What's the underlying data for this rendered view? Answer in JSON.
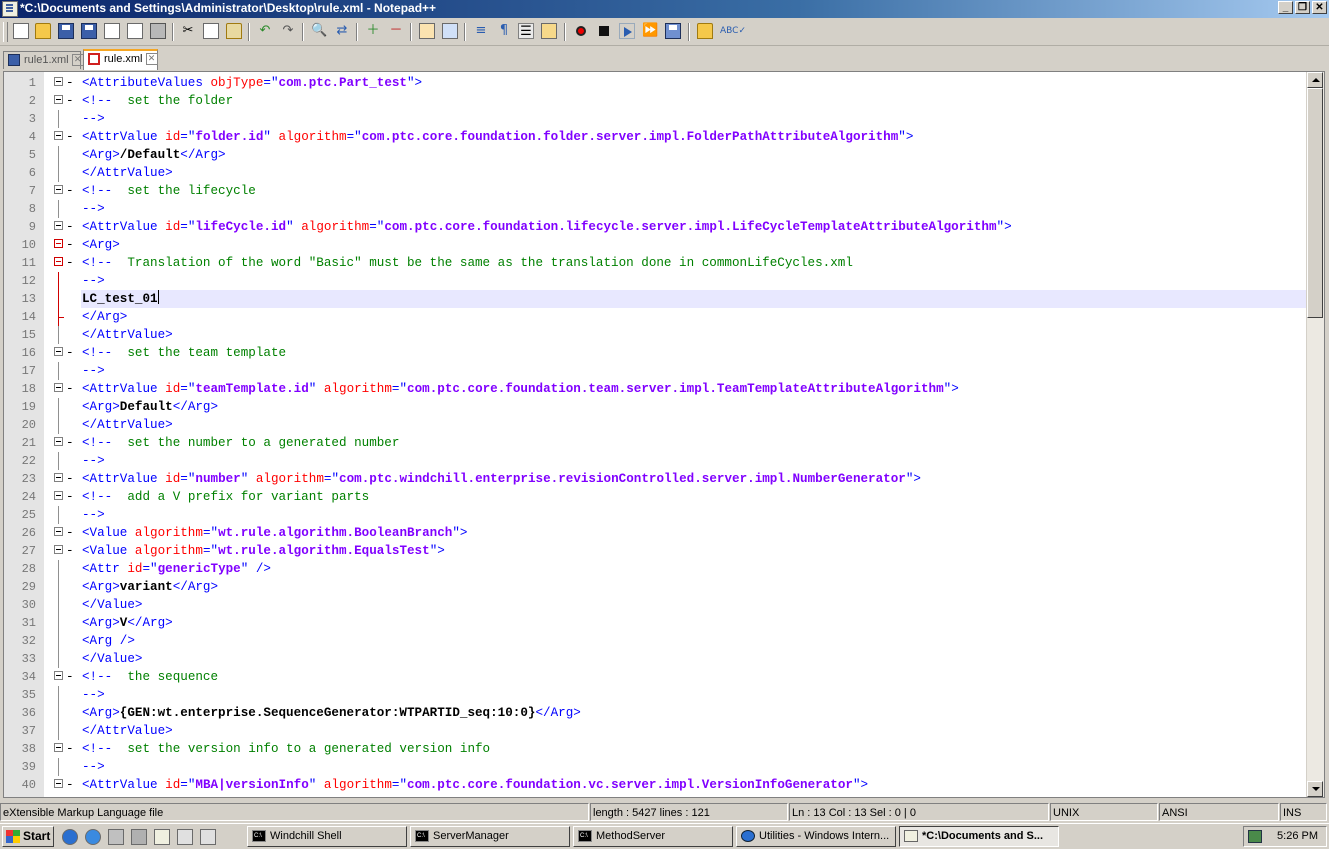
{
  "window": {
    "title": "*C:\\Documents and Settings\\Administrator\\Desktop\\rule.xml - Notepad++",
    "controls": {
      "minimize": "_",
      "restore": "❐",
      "close": "✕"
    }
  },
  "toolbar": {
    "icons": [
      "new-file-icon",
      "open-file-icon",
      "save-icon",
      "save-all-icon",
      "close-icon",
      "close-all-icon",
      "print-icon",
      "cut-icon",
      "copy-icon",
      "paste-icon",
      "undo-icon",
      "redo-icon",
      "find-icon",
      "replace-icon",
      "zoom-in-icon",
      "zoom-out-icon",
      "sync-vertical-icon",
      "sync-horizontal-icon",
      "word-wrap-icon",
      "show-all-chars-icon",
      "indent-guide-icon",
      "user-lang-icon",
      "record-macro-icon",
      "stop-record-icon",
      "play-macro-icon",
      "run-macro-multiple-icon",
      "save-macro-icon",
      "launch-browser-icon",
      "spell-check-icon"
    ]
  },
  "tabs": [
    {
      "label": "rule1.xml",
      "active": false,
      "state": "saved"
    },
    {
      "label": "rule.xml",
      "active": true,
      "state": "modified"
    }
  ],
  "editor": {
    "current_line": 13,
    "lines": [
      {
        "n": "1",
        "fold": "open",
        "parts": [
          [
            "t",
            "<AttributeValues "
          ],
          [
            "a",
            "objType"
          ],
          [
            "t",
            "=\""
          ],
          [
            "v",
            "com.ptc.Part_test"
          ],
          [
            "t",
            "\">"
          ]
        ]
      },
      {
        "n": "2",
        "fold": "open",
        "parts": [
          [
            "t",
            "<!-- "
          ],
          [
            "c",
            " set the folder"
          ]
        ]
      },
      {
        "n": "3",
        "fold": "line",
        "parts": [
          [
            "t",
            "-->"
          ]
        ]
      },
      {
        "n": "4",
        "fold": "open",
        "parts": [
          [
            "t",
            "<AttrValue "
          ],
          [
            "a",
            "id"
          ],
          [
            "t",
            "=\""
          ],
          [
            "v",
            "folder.id"
          ],
          [
            "t",
            "\" "
          ],
          [
            "a",
            "algorithm"
          ],
          [
            "t",
            "=\""
          ],
          [
            "v",
            "com.ptc.core.foundation.folder.server.impl.FolderPathAttributeAlgorithm"
          ],
          [
            "t",
            "\">"
          ]
        ]
      },
      {
        "n": "5",
        "fold": "line",
        "parts": [
          [
            "t",
            "<Arg>"
          ],
          [
            "x",
            "/Default"
          ],
          [
            "t",
            "</Arg>"
          ]
        ]
      },
      {
        "n": "6",
        "fold": "line",
        "parts": [
          [
            "t",
            "</AttrValue>"
          ]
        ]
      },
      {
        "n": "7",
        "fold": "open",
        "parts": [
          [
            "t",
            "<!-- "
          ],
          [
            "c",
            " set the lifecycle"
          ]
        ]
      },
      {
        "n": "8",
        "fold": "line",
        "parts": [
          [
            "t",
            "-->"
          ]
        ]
      },
      {
        "n": "9",
        "fold": "open",
        "parts": [
          [
            "t",
            "<AttrValue "
          ],
          [
            "a",
            "id"
          ],
          [
            "t",
            "=\""
          ],
          [
            "v",
            "lifeCycle.id"
          ],
          [
            "t",
            "\" "
          ],
          [
            "a",
            "algorithm"
          ],
          [
            "t",
            "=\""
          ],
          [
            "v",
            "com.ptc.core.foundation.lifecycle.server.impl.LifeCycleTemplateAttributeAlgorithm"
          ],
          [
            "t",
            "\">"
          ]
        ]
      },
      {
        "n": "10",
        "fold": "open-red",
        "parts": [
          [
            "t",
            "<Arg>"
          ]
        ]
      },
      {
        "n": "11",
        "fold": "open-red",
        "parts": [
          [
            "t",
            "<!-- "
          ],
          [
            "c",
            " Translation of the word \"Basic\" must be the same as the translation done in commonLifeCycles.xml"
          ]
        ]
      },
      {
        "n": "12",
        "fold": "line-red",
        "parts": [
          [
            "t",
            "-->"
          ]
        ]
      },
      {
        "n": "13",
        "fold": "line-red",
        "parts": [
          [
            "x",
            "LC_test_01"
          ]
        ]
      },
      {
        "n": "14",
        "fold": "end-red",
        "parts": [
          [
            "t",
            "</Arg>"
          ]
        ]
      },
      {
        "n": "15",
        "fold": "line",
        "parts": [
          [
            "t",
            "</AttrValue>"
          ]
        ]
      },
      {
        "n": "16",
        "fold": "open",
        "parts": [
          [
            "t",
            "<!-- "
          ],
          [
            "c",
            " set the team template"
          ]
        ]
      },
      {
        "n": "17",
        "fold": "line",
        "parts": [
          [
            "t",
            "-->"
          ]
        ]
      },
      {
        "n": "18",
        "fold": "open",
        "parts": [
          [
            "t",
            "<AttrValue "
          ],
          [
            "a",
            "id"
          ],
          [
            "t",
            "=\""
          ],
          [
            "v",
            "teamTemplate.id"
          ],
          [
            "t",
            "\" "
          ],
          [
            "a",
            "algorithm"
          ],
          [
            "t",
            "=\""
          ],
          [
            "v",
            "com.ptc.core.foundation.team.server.impl.TeamTemplateAttributeAlgorithm"
          ],
          [
            "t",
            "\">"
          ]
        ]
      },
      {
        "n": "19",
        "fold": "line",
        "parts": [
          [
            "t",
            "<Arg>"
          ],
          [
            "x",
            "Default"
          ],
          [
            "t",
            "</Arg>"
          ]
        ]
      },
      {
        "n": "20",
        "fold": "line",
        "parts": [
          [
            "t",
            "</AttrValue>"
          ]
        ]
      },
      {
        "n": "21",
        "fold": "open",
        "parts": [
          [
            "t",
            "<!-- "
          ],
          [
            "c",
            " set the number to a generated number"
          ]
        ]
      },
      {
        "n": "22",
        "fold": "line",
        "parts": [
          [
            "t",
            "-->"
          ]
        ]
      },
      {
        "n": "23",
        "fold": "open",
        "parts": [
          [
            "t",
            "<AttrValue "
          ],
          [
            "a",
            "id"
          ],
          [
            "t",
            "=\""
          ],
          [
            "v",
            "number"
          ],
          [
            "t",
            "\" "
          ],
          [
            "a",
            "algorithm"
          ],
          [
            "t",
            "=\""
          ],
          [
            "v",
            "com.ptc.windchill.enterprise.revisionControlled.server.impl.NumberGenerator"
          ],
          [
            "t",
            "\">"
          ]
        ]
      },
      {
        "n": "24",
        "fold": "open",
        "parts": [
          [
            "t",
            "<!-- "
          ],
          [
            "c",
            " add a V prefix for variant parts"
          ]
        ]
      },
      {
        "n": "25",
        "fold": "line",
        "parts": [
          [
            "t",
            "-->"
          ]
        ]
      },
      {
        "n": "26",
        "fold": "open",
        "parts": [
          [
            "t",
            "<Value "
          ],
          [
            "a",
            "algorithm"
          ],
          [
            "t",
            "=\""
          ],
          [
            "v",
            "wt.rule.algorithm.BooleanBranch"
          ],
          [
            "t",
            "\">"
          ]
        ]
      },
      {
        "n": "27",
        "fold": "open",
        "parts": [
          [
            "t",
            "<Value "
          ],
          [
            "a",
            "algorithm"
          ],
          [
            "t",
            "=\""
          ],
          [
            "v",
            "wt.rule.algorithm.EqualsTest"
          ],
          [
            "t",
            "\">"
          ]
        ]
      },
      {
        "n": "28",
        "fold": "line",
        "parts": [
          [
            "t",
            "<Attr "
          ],
          [
            "a",
            "id"
          ],
          [
            "t",
            "=\""
          ],
          [
            "v",
            "genericType"
          ],
          [
            "t",
            "\" />"
          ]
        ]
      },
      {
        "n": "29",
        "fold": "line",
        "parts": [
          [
            "t",
            "<Arg>"
          ],
          [
            "x",
            "variant"
          ],
          [
            "t",
            "</Arg>"
          ]
        ]
      },
      {
        "n": "30",
        "fold": "line",
        "parts": [
          [
            "t",
            "</Value>"
          ]
        ]
      },
      {
        "n": "31",
        "fold": "line",
        "parts": [
          [
            "t",
            "<Arg>"
          ],
          [
            "x",
            "V"
          ],
          [
            "t",
            "</Arg>"
          ]
        ]
      },
      {
        "n": "32",
        "fold": "line",
        "parts": [
          [
            "t",
            "<Arg />"
          ]
        ]
      },
      {
        "n": "33",
        "fold": "line",
        "parts": [
          [
            "t",
            "</Value>"
          ]
        ]
      },
      {
        "n": "34",
        "fold": "open",
        "parts": [
          [
            "t",
            "<!-- "
          ],
          [
            "c",
            " the sequence"
          ]
        ]
      },
      {
        "n": "35",
        "fold": "line",
        "parts": [
          [
            "t",
            "-->"
          ]
        ]
      },
      {
        "n": "36",
        "fold": "line",
        "parts": [
          [
            "t",
            "<Arg>"
          ],
          [
            "x",
            "{GEN:wt.enterprise.SequenceGenerator:WTPARTID_seq:10:0}"
          ],
          [
            "t",
            "</Arg>"
          ]
        ]
      },
      {
        "n": "37",
        "fold": "line",
        "parts": [
          [
            "t",
            "</AttrValue>"
          ]
        ]
      },
      {
        "n": "38",
        "fold": "open",
        "parts": [
          [
            "t",
            "<!-- "
          ],
          [
            "c",
            " set the version info to a generated version info"
          ]
        ]
      },
      {
        "n": "39",
        "fold": "line",
        "parts": [
          [
            "t",
            "-->"
          ]
        ]
      },
      {
        "n": "40",
        "fold": "open",
        "parts": [
          [
            "t",
            "<AttrValue "
          ],
          [
            "a",
            "id"
          ],
          [
            "t",
            "=\""
          ],
          [
            "v",
            "MBA|versionInfo"
          ],
          [
            "t",
            "\" "
          ],
          [
            "a",
            "algorithm"
          ],
          [
            "t",
            "=\""
          ],
          [
            "v",
            "com.ptc.core.foundation.vc.server.impl.VersionInfoGenerator"
          ],
          [
            "t",
            "\">"
          ]
        ]
      }
    ]
  },
  "statusbar": {
    "filetype": "eXtensible Markup Language file",
    "length": "length : 5427    lines : 121",
    "position": "Ln : 13    Col : 13    Sel : 0 | 0",
    "eol": "UNIX",
    "encoding": "ANSI",
    "mode": "INS"
  },
  "taskbar": {
    "start_label": "Start",
    "buttons": [
      {
        "label": "Windchill Shell",
        "icon": "console-icon"
      },
      {
        "label": "ServerManager",
        "icon": "console-icon"
      },
      {
        "label": "MethodServer",
        "icon": "console-icon"
      },
      {
        "label": "Utilities - Windows Intern...",
        "icon": "ie-icon"
      },
      {
        "label": "*C:\\Documents and S...",
        "icon": "notepad-icon",
        "active": true
      }
    ],
    "clock": "5:26 PM"
  }
}
